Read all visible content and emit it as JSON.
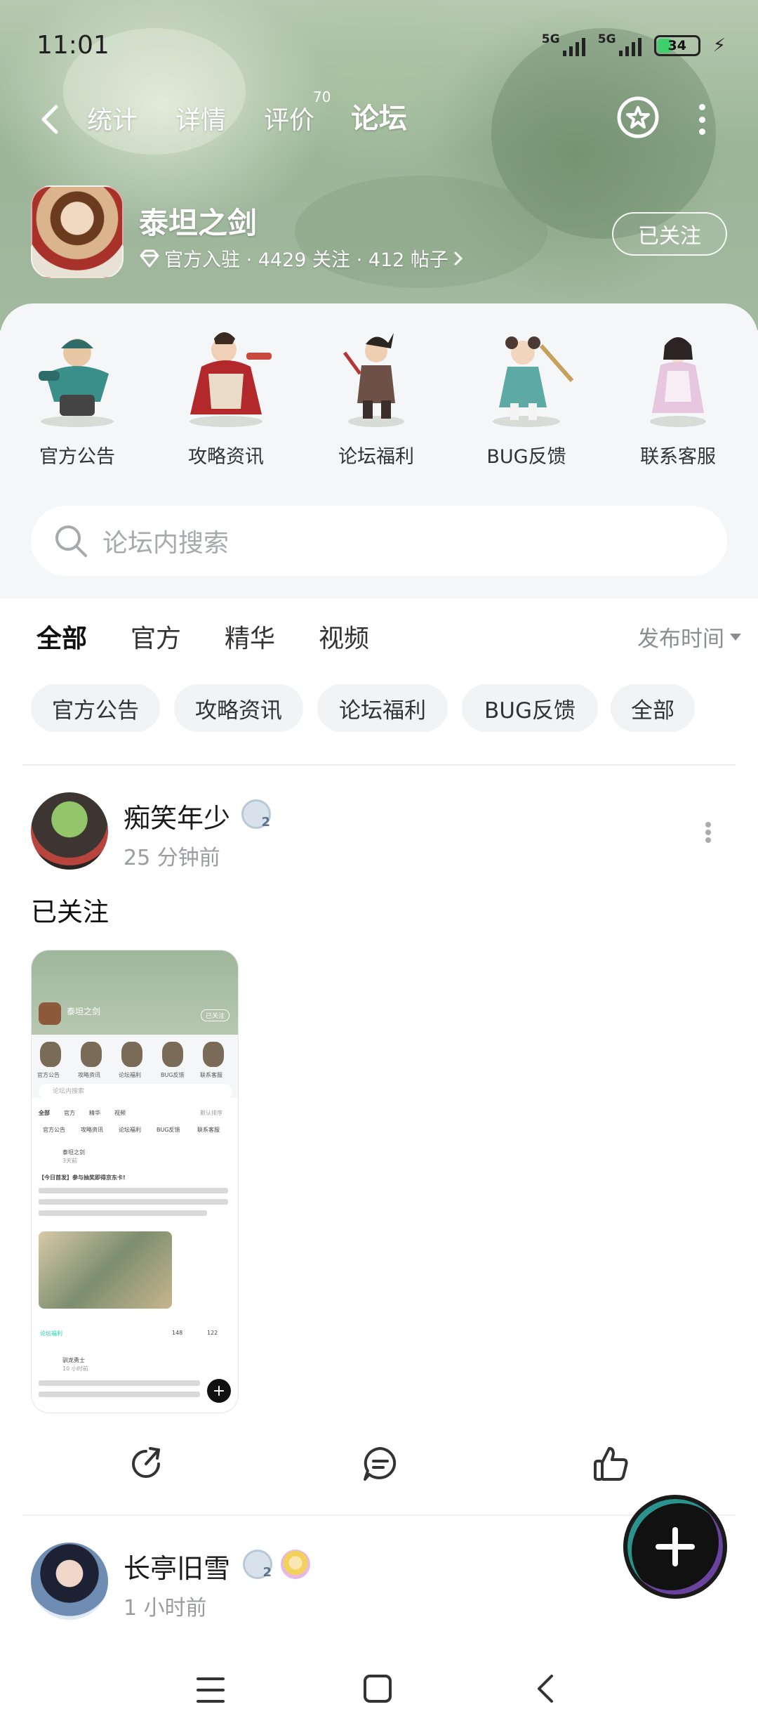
{
  "status": {
    "time": "11:01",
    "signal1": "5G",
    "signal2": "5G",
    "battery": "34"
  },
  "nav": {
    "tabs": [
      {
        "label": "统计"
      },
      {
        "label": "详情"
      },
      {
        "label": "评价"
      },
      {
        "label": "论坛"
      }
    ],
    "review_count": "70",
    "active_tab": "论坛"
  },
  "game": {
    "title": "泰坦之剑",
    "meta": "官方入驻 · 4429 关注 · 412 帖子",
    "follow_label": "已关注"
  },
  "categories": [
    {
      "label": "官方公告"
    },
    {
      "label": "攻略资讯"
    },
    {
      "label": "论坛福利"
    },
    {
      "label": "BUG反馈"
    },
    {
      "label": "联系客服"
    }
  ],
  "search": {
    "placeholder": "论坛内搜索"
  },
  "filter_tabs": [
    {
      "label": "全部"
    },
    {
      "label": "官方"
    },
    {
      "label": "精华"
    },
    {
      "label": "视频"
    }
  ],
  "sort_label": "发布时间",
  "chips": [
    {
      "label": "官方公告"
    },
    {
      "label": "攻略资讯"
    },
    {
      "label": "论坛福利"
    },
    {
      "label": "BUG反馈"
    },
    {
      "label": "全部"
    }
  ],
  "posts": [
    {
      "username": "痴笑年少",
      "time": "25 分钟前",
      "text": "已关注",
      "screenshot": {
        "title": "泰坦之剑",
        "follow": "已关注",
        "search": "论坛内搜索",
        "cats": [
          "官方公告",
          "攻略资讯",
          "论坛福利",
          "BUG反馈",
          "联系客服"
        ],
        "tabs": [
          "全部",
          "官方",
          "精华",
          "视频"
        ],
        "sort": "默认排序",
        "chips": [
          "官方公告",
          "攻略资讯",
          "论坛福利",
          "BUG反馈",
          "联系客服"
        ],
        "post1_user": "泰坦之剑",
        "post1_time": "3天前",
        "post1_title": "【今日首发】参与抽奖即得京东卡!",
        "post1_tag": "论坛福利",
        "post1_comments": "148",
        "post1_likes": "122",
        "post2_user": "驯龙勇士",
        "post2_time": "10 小时前"
      }
    },
    {
      "username": "长亭旧雪",
      "time": "1 小时前"
    }
  ],
  "icons": {
    "back": "chevron-left-icon",
    "star": "star-icon",
    "more": "more-vertical-icon",
    "search": "search-icon",
    "share": "share-icon",
    "comment": "comment-icon",
    "like": "thumbs-up-icon",
    "fab": "plus-icon"
  },
  "colors": {
    "accent": "#1ed2b4",
    "banner": "#9bb598",
    "panel": "#f5f6f8"
  }
}
